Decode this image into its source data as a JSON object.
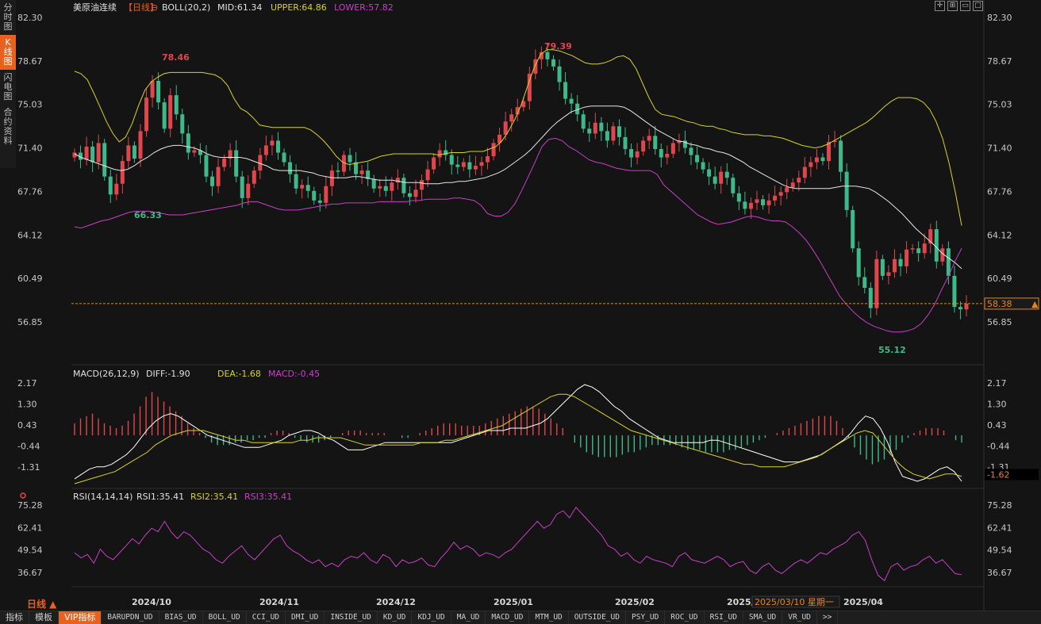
{
  "sidebar": {
    "tabs": [
      "分\n时\n图",
      "K\n线\n图",
      "闪\n电\n图",
      "合\n约\n资\n料"
    ],
    "active_index": 1
  },
  "header": {
    "symbol": "美原油连续",
    "period": "【日线】",
    "boll_label": "BOLL(20,2)",
    "mid": "MID:61.34",
    "upper": "UPPER:64.86",
    "lower": "LOWER:57.82"
  },
  "macd_header": {
    "label": "MACD(26,12,9)",
    "diff": "DIFF:-1.90",
    "dea": "DEA:-1.68",
    "macd": "MACD:-0.45"
  },
  "rsi_header": {
    "label": "RSI(14,14,14)",
    "rsi1": "RSI1:35.41",
    "rsi2": "RSI2:35.41",
    "rsi3": "RSI3:35.41"
  },
  "price_axis": [
    "82.30",
    "78.67",
    "75.03",
    "71.40",
    "67.76",
    "64.12",
    "60.49",
    "56.85"
  ],
  "macd_axis": [
    "2.17",
    "1.30",
    "0.43",
    "-0.44",
    "-1.31"
  ],
  "rsi_axis": [
    "75.28",
    "62.41",
    "49.54",
    "36.67"
  ],
  "current_price": "58.38",
  "current_macd": "-1.62",
  "annotations": {
    "high1": "78.46",
    "low1": "66.33",
    "high2": "79.39",
    "low2": "55.12"
  },
  "x_labels": [
    "2024/10",
    "2024/11",
    "2024/12",
    "2025/01",
    "2025/02",
    "2025/",
    "2025/04"
  ],
  "crosshair_date": "2025/03/10 星期一",
  "period_selector": "日线 ▲",
  "bottom_tabs": [
    "指标",
    "模板",
    "VIP指标",
    "BARUPDN_UD",
    "BIAS_UD",
    "BOLL_UD",
    "CCI_UD",
    "DMI_UD",
    "INSIDE_UD",
    "KD_UD",
    "KDJ_UD",
    "MA_UD",
    "MACD_UD",
    "MTM_UD",
    "OUTSIDE_UD",
    "PSY_UD",
    "ROC_UD",
    "RSI_UD",
    "SMA_UD",
    "VR_UD",
    ">>"
  ],
  "colors": {
    "up": "#e0474c",
    "down": "#3fb98b",
    "mid": "#e6e6e6",
    "upper": "#d8d22a",
    "lower": "#c83fc8",
    "accent": "#e8611d"
  },
  "chart_data": {
    "type": "candlestick",
    "price_ylim": [
      55.12,
      82.3
    ],
    "closes": [
      71.0,
      70.4,
      71.5,
      70.2,
      71.8,
      69.0,
      67.5,
      68.4,
      70.3,
      71.6,
      70.5,
      72.8,
      75.6,
      77.0,
      75.2,
      73.0,
      75.8,
      74.2,
      72.6,
      71.0,
      71.2,
      70.8,
      69.0,
      68.2,
      69.8,
      70.5,
      71.2,
      69.0,
      67.2,
      68.4,
      69.5,
      70.8,
      71.6,
      72.0,
      71.0,
      70.2,
      69.2,
      68.0,
      68.3,
      67.8,
      67.0,
      66.8,
      68.2,
      69.5,
      69.4,
      70.8,
      70.2,
      69.2,
      69.5,
      68.8,
      68.0,
      68.2,
      67.8,
      68.5,
      68.9,
      67.6,
      67.3,
      67.9,
      68.7,
      69.6,
      70.6,
      71.2,
      70.8,
      70.0,
      69.8,
      70.2,
      69.6,
      69.9,
      70.2,
      70.7,
      71.8,
      72.5,
      73.6,
      74.2,
      74.8,
      75.3,
      77.6,
      78.8,
      79.4,
      78.8,
      78.2,
      76.9,
      75.5,
      75.1,
      74.2,
      73.0,
      72.6,
      73.5,
      72.8,
      72.0,
      73.2,
      72.3,
      71.3,
      70.6,
      71.1,
      72.0,
      72.4,
      71.3,
      70.6,
      70.9,
      71.8,
      72.0,
      71.4,
      70.8,
      70.2,
      69.6,
      69.0,
      68.4,
      69.4,
      68.9,
      67.6,
      66.9,
      66.3,
      66.8,
      67.1,
      66.6,
      67.0,
      67.4,
      67.7,
      68.1,
      68.5,
      68.9,
      69.8,
      70.2,
      70.6,
      70.3,
      71.9,
      72.0,
      69.4,
      66.2,
      63.0,
      60.6,
      59.7,
      58.0,
      62.1,
      60.7,
      61.0,
      62.1,
      61.5,
      62.9,
      63.0,
      62.6,
      63.4,
      64.6,
      61.9,
      63.0,
      60.7,
      58.1,
      57.9,
      58.38
    ],
    "upper_band": [
      77.8,
      77.6,
      77.1,
      76.0,
      74.8,
      73.6,
      72.6,
      71.9,
      72.3,
      73.4,
      74.9,
      76.2,
      76.9,
      77.3,
      77.6,
      77.7,
      77.7,
      77.7,
      77.7,
      77.7,
      77.7,
      77.6,
      77.5,
      77.2,
      76.6,
      75.5,
      74.7,
      74.4,
      73.9,
      73.3,
      73.2,
      73.1,
      73.1,
      73.1,
      73.1,
      73.1,
      73.1,
      72.9,
      72.5,
      72.0,
      71.4,
      70.7,
      70.2,
      70.0,
      70.1,
      70.2,
      70.3,
      70.5,
      70.7,
      70.8,
      70.9,
      70.9,
      70.9,
      70.9,
      70.9,
      70.9,
      70.9,
      70.8,
      70.9,
      71.0,
      71.0,
      71.0,
      71.1,
      71.1,
      71.1,
      71.3,
      71.5,
      72.0,
      72.8,
      73.8,
      75.0,
      76.6,
      78.1,
      79.2,
      79.6,
      79.6,
      79.5,
      79.3,
      79.1,
      78.8,
      78.5,
      78.4,
      78.4,
      78.5,
      78.7,
      79.0,
      79.1,
      78.8,
      78.0,
      76.8,
      75.6,
      74.6,
      74.2,
      74.1,
      74.0,
      73.8,
      73.6,
      73.5,
      73.3,
      73.2,
      73.2,
      73.0,
      72.9,
      72.7,
      72.6,
      72.5,
      72.5,
      72.5,
      72.4,
      72.4,
      72.3,
      72.2,
      72.0,
      71.8,
      71.6,
      71.5,
      71.4,
      71.5,
      71.7,
      72.0,
      72.3,
      72.6,
      72.9,
      73.2,
      73.5,
      73.9,
      74.4,
      74.9,
      75.3,
      75.6,
      75.6,
      75.6,
      75.5,
      75.2,
      74.6,
      73.6,
      72.2,
      70.2,
      67.7,
      64.9
    ],
    "mid_band": [
      70.9,
      70.6,
      70.4,
      70.2,
      70.0,
      69.8,
      69.6,
      69.5,
      69.6,
      69.9,
      70.3,
      70.6,
      71.0,
      71.3,
      71.5,
      71.6,
      71.6,
      71.5,
      71.4,
      71.2,
      70.9,
      70.7,
      70.6,
      70.6,
      70.6,
      70.6,
      70.5,
      70.3,
      70.1,
      69.9,
      69.6,
      69.5,
      69.5,
      69.5,
      69.5,
      69.4,
      69.3,
      69.1,
      69.0,
      68.9,
      68.9,
      68.9,
      69.0,
      69.0,
      68.9,
      68.8,
      68.7,
      68.7,
      68.7,
      68.6,
      68.5,
      68.5,
      68.5,
      68.4,
      68.4,
      68.4,
      68.5,
      68.5,
      68.6,
      68.6,
      68.7,
      68.8,
      68.9,
      69.1,
      69.3,
      69.6,
      70.0,
      70.4,
      70.8,
      71.3,
      71.9,
      72.5,
      73.1,
      73.6,
      74.0,
      74.4,
      74.6,
      74.8,
      74.9,
      74.9,
      74.9,
      74.9,
      74.9,
      74.8,
      74.5,
      74.1,
      73.7,
      73.3,
      72.9,
      72.6,
      72.3,
      72.0,
      71.9,
      71.7,
      71.6,
      71.4,
      71.3,
      71.1,
      71.0,
      70.8,
      70.5,
      70.2,
      69.8,
      69.5,
      69.2,
      68.9,
      68.6,
      68.3,
      68.1,
      68.0,
      68.0,
      68.0,
      68.0,
      68.0,
      68.0,
      68.1,
      68.2,
      68.2,
      68.2,
      68.1,
      68.0,
      67.7,
      67.3,
      66.9,
      66.4,
      65.9,
      65.3,
      64.7,
      64.2,
      63.7,
      63.2,
      62.6,
      62.2,
      61.8,
      61.3
    ],
    "lower_band": [
      64.8,
      64.7,
      64.9,
      65.1,
      65.3,
      65.4,
      65.6,
      65.8,
      66.0,
      66.1,
      66.1,
      66.1,
      66.0,
      65.9,
      65.8,
      65.8,
      65.8,
      65.9,
      66.0,
      66.1,
      66.2,
      66.3,
      66.4,
      66.5,
      66.6,
      66.8,
      66.9,
      66.9,
      66.7,
      66.5,
      66.3,
      66.2,
      66.2,
      66.2,
      66.3,
      66.4,
      66.5,
      66.6,
      66.7,
      66.7,
      66.8,
      66.8,
      66.8,
      66.8,
      66.8,
      66.9,
      66.9,
      66.9,
      66.9,
      66.9,
      67.0,
      67.0,
      67.1,
      67.1,
      67.1,
      67.1,
      67.2,
      67.2,
      67.1,
      67.0,
      66.6,
      65.9,
      65.7,
      65.7,
      66.0,
      66.7,
      67.8,
      69.0,
      70.2,
      71.5,
      72.1,
      72.2,
      72.0,
      71.5,
      71.2,
      70.8,
      70.4,
      70.2,
      70.1,
      69.9,
      69.7,
      69.6,
      69.5,
      69.5,
      69.5,
      69.5,
      69.2,
      68.3,
      67.8,
      67.3,
      66.8,
      66.3,
      65.8,
      65.5,
      65.2,
      65.0,
      65.1,
      65.2,
      65.4,
      65.6,
      65.7,
      65.6,
      65.4,
      65.3,
      65.3,
      65.2,
      64.8,
      64.3,
      63.7,
      62.9,
      62.0,
      61.0,
      60.0,
      59.0,
      58.3,
      57.7,
      57.2,
      56.8,
      56.5,
      56.3,
      56.1,
      56.0,
      56.0,
      56.1,
      56.3,
      56.7,
      57.4,
      58.3,
      59.5,
      60.6,
      61.9,
      63.0
    ],
    "macd_ylim": [
      -1.9,
      2.3
    ],
    "macd_hist": [
      0.5,
      0.7,
      0.8,
      0.9,
      0.7,
      0.5,
      0.4,
      0.3,
      0.4,
      0.6,
      0.9,
      1.2,
      1.6,
      1.8,
      1.6,
      1.4,
      1.2,
      1.0,
      0.8,
      0.5,
      0.3,
      0.1,
      -0.1,
      -0.3,
      -0.4,
      -0.4,
      -0.4,
      -0.3,
      -0.3,
      -0.2,
      -0.2,
      -0.1,
      -0.1,
      0.1,
      0.2,
      0.2,
      0.1,
      -0.1,
      -0.2,
      -0.3,
      -0.3,
      -0.3,
      -0.2,
      -0.1,
      0.0,
      0.1,
      0.2,
      0.2,
      0.2,
      0.1,
      0.1,
      0.1,
      0.1,
      0.0,
      0.0,
      -0.1,
      -0.1,
      0.0,
      0.1,
      0.2,
      0.3,
      0.4,
      0.5,
      0.5,
      0.5,
      0.4,
      0.4,
      0.4,
      0.4,
      0.5,
      0.6,
      0.7,
      0.8,
      0.9,
      1.0,
      1.1,
      1.2,
      1.2,
      1.1,
      0.9,
      0.7,
      0.5,
      0.3,
      0.0,
      -0.3,
      -0.5,
      -0.7,
      -0.8,
      -0.9,
      -0.9,
      -0.9,
      -0.9,
      -0.8,
      -0.7,
      -0.7,
      -0.6,
      -0.5,
      -0.4,
      -0.4,
      -0.4,
      -0.4,
      -0.4,
      -0.5,
      -0.6,
      -0.6,
      -0.6,
      -0.7,
      -0.7,
      -0.7,
      -0.7,
      -0.6,
      -0.6,
      -0.5,
      -0.4,
      -0.3,
      -0.2,
      -0.1,
      0.0,
      0.1,
      0.2,
      0.3,
      0.4,
      0.5,
      0.6,
      0.7,
      0.8,
      0.8,
      0.8,
      0.6,
      0.3,
      -0.1,
      -0.5,
      -0.8,
      -1.0,
      -1.2,
      -1.1,
      -1.0,
      -0.8,
      -0.6,
      -0.3,
      -0.1,
      0.1,
      0.2,
      0.3,
      0.3,
      0.3,
      0.2,
      0.0,
      -0.2,
      -0.3
    ],
    "macd_diff": [
      -1.8,
      -1.6,
      -1.4,
      -1.3,
      -1.3,
      -1.2,
      -1.0,
      -0.8,
      -0.5,
      -0.1,
      0.3,
      0.6,
      0.8,
      0.9,
      0.8,
      0.6,
      0.4,
      0.2,
      0.0,
      -0.1,
      -0.2,
      -0.3,
      -0.4,
      -0.5,
      -0.5,
      -0.5,
      -0.4,
      -0.3,
      -0.2,
      0.0,
      0.1,
      0.2,
      0.2,
      0.1,
      -0.1,
      -0.2,
      -0.4,
      -0.6,
      -0.6,
      -0.6,
      -0.5,
      -0.4,
      -0.3,
      -0.3,
      -0.3,
      -0.3,
      -0.3,
      -0.3,
      -0.3,
      -0.3,
      -0.3,
      -0.3,
      -0.2,
      -0.1,
      0.0,
      0.1,
      0.2,
      0.2,
      0.2,
      0.3,
      0.3,
      0.3,
      0.4,
      0.5,
      0.7,
      1.0,
      1.3,
      1.6,
      1.9,
      2.1,
      2.0,
      1.8,
      1.5,
      1.2,
      1.0,
      0.7,
      0.5,
      0.3,
      0.1,
      -0.1,
      -0.2,
      -0.3,
      -0.3,
      -0.3,
      -0.3,
      -0.3,
      -0.2,
      -0.2,
      -0.3,
      -0.4,
      -0.5,
      -0.6,
      -0.7,
      -0.8,
      -0.9,
      -1.0,
      -1.1,
      -1.1,
      -1.1,
      -1.0,
      -0.9,
      -0.8,
      -0.6,
      -0.4,
      -0.2,
      0.1,
      0.5,
      0.8,
      0.7,
      0.3,
      -0.3,
      -1.1,
      -1.7,
      -1.8,
      -1.9,
      -1.8,
      -1.6,
      -1.4,
      -1.3,
      -1.5,
      -1.9
    ],
    "macd_dea": [
      -2.0,
      -1.9,
      -1.8,
      -1.7,
      -1.6,
      -1.5,
      -1.3,
      -1.1,
      -0.9,
      -0.7,
      -0.4,
      -0.2,
      0.0,
      0.1,
      0.2,
      0.2,
      0.2,
      0.1,
      0.0,
      -0.1,
      -0.2,
      -0.2,
      -0.3,
      -0.3,
      -0.3,
      -0.3,
      -0.3,
      -0.3,
      -0.2,
      -0.2,
      -0.1,
      -0.1,
      -0.1,
      -0.1,
      -0.2,
      -0.3,
      -0.4,
      -0.4,
      -0.4,
      -0.4,
      -0.4,
      -0.4,
      -0.4,
      -0.3,
      -0.3,
      -0.3,
      -0.2,
      -0.2,
      -0.1,
      0.0,
      0.1,
      0.2,
      0.3,
      0.4,
      0.6,
      0.8,
      1.0,
      1.2,
      1.4,
      1.6,
      1.7,
      1.7,
      1.6,
      1.4,
      1.2,
      1.0,
      0.8,
      0.6,
      0.4,
      0.2,
      0.1,
      0.0,
      -0.1,
      -0.2,
      -0.3,
      -0.4,
      -0.5,
      -0.6,
      -0.7,
      -0.8,
      -0.9,
      -1.0,
      -1.1,
      -1.2,
      -1.2,
      -1.3,
      -1.3,
      -1.3,
      -1.3,
      -1.2,
      -1.1,
      -1.0,
      -0.9,
      -0.7,
      -0.5,
      -0.3,
      -0.1,
      0.1,
      0.2,
      0.1,
      -0.3,
      -0.7,
      -1.1,
      -1.4,
      -1.6,
      -1.7,
      -1.8,
      -1.7,
      -1.6,
      -1.6,
      -1.7
    ],
    "rsi_ylim": [
      30,
      78
    ],
    "rsi1": [
      48,
      45,
      47,
      42,
      50,
      46,
      44,
      48,
      52,
      56,
      53,
      58,
      62,
      60,
      66,
      60,
      56,
      60,
      58,
      54,
      50,
      48,
      44,
      42,
      46,
      49,
      52,
      47,
      44,
      48,
      52,
      56,
      58,
      52,
      49,
      47,
      44,
      42,
      44,
      40,
      42,
      40,
      44,
      46,
      45,
      48,
      44,
      42,
      47,
      45,
      40,
      44,
      42,
      43,
      45,
      41,
      40,
      45,
      49,
      54,
      50,
      52,
      50,
      46,
      48,
      47,
      45,
      48,
      50,
      54,
      58,
      62,
      66,
      62,
      64,
      70,
      72,
      68,
      74,
      70,
      66,
      62,
      58,
      52,
      50,
      46,
      48,
      44,
      42,
      46,
      44,
      43,
      42,
      40,
      46,
      48,
      44,
      43,
      42,
      44,
      46,
      44,
      40,
      42,
      43,
      38,
      36,
      40,
      42,
      38,
      36,
      39,
      42,
      44,
      42,
      45,
      48,
      47,
      50,
      52,
      54,
      58,
      60,
      55,
      44,
      35,
      32,
      40,
      42,
      38,
      40,
      41,
      44,
      46,
      42,
      44,
      40,
      36,
      35.4
    ]
  }
}
